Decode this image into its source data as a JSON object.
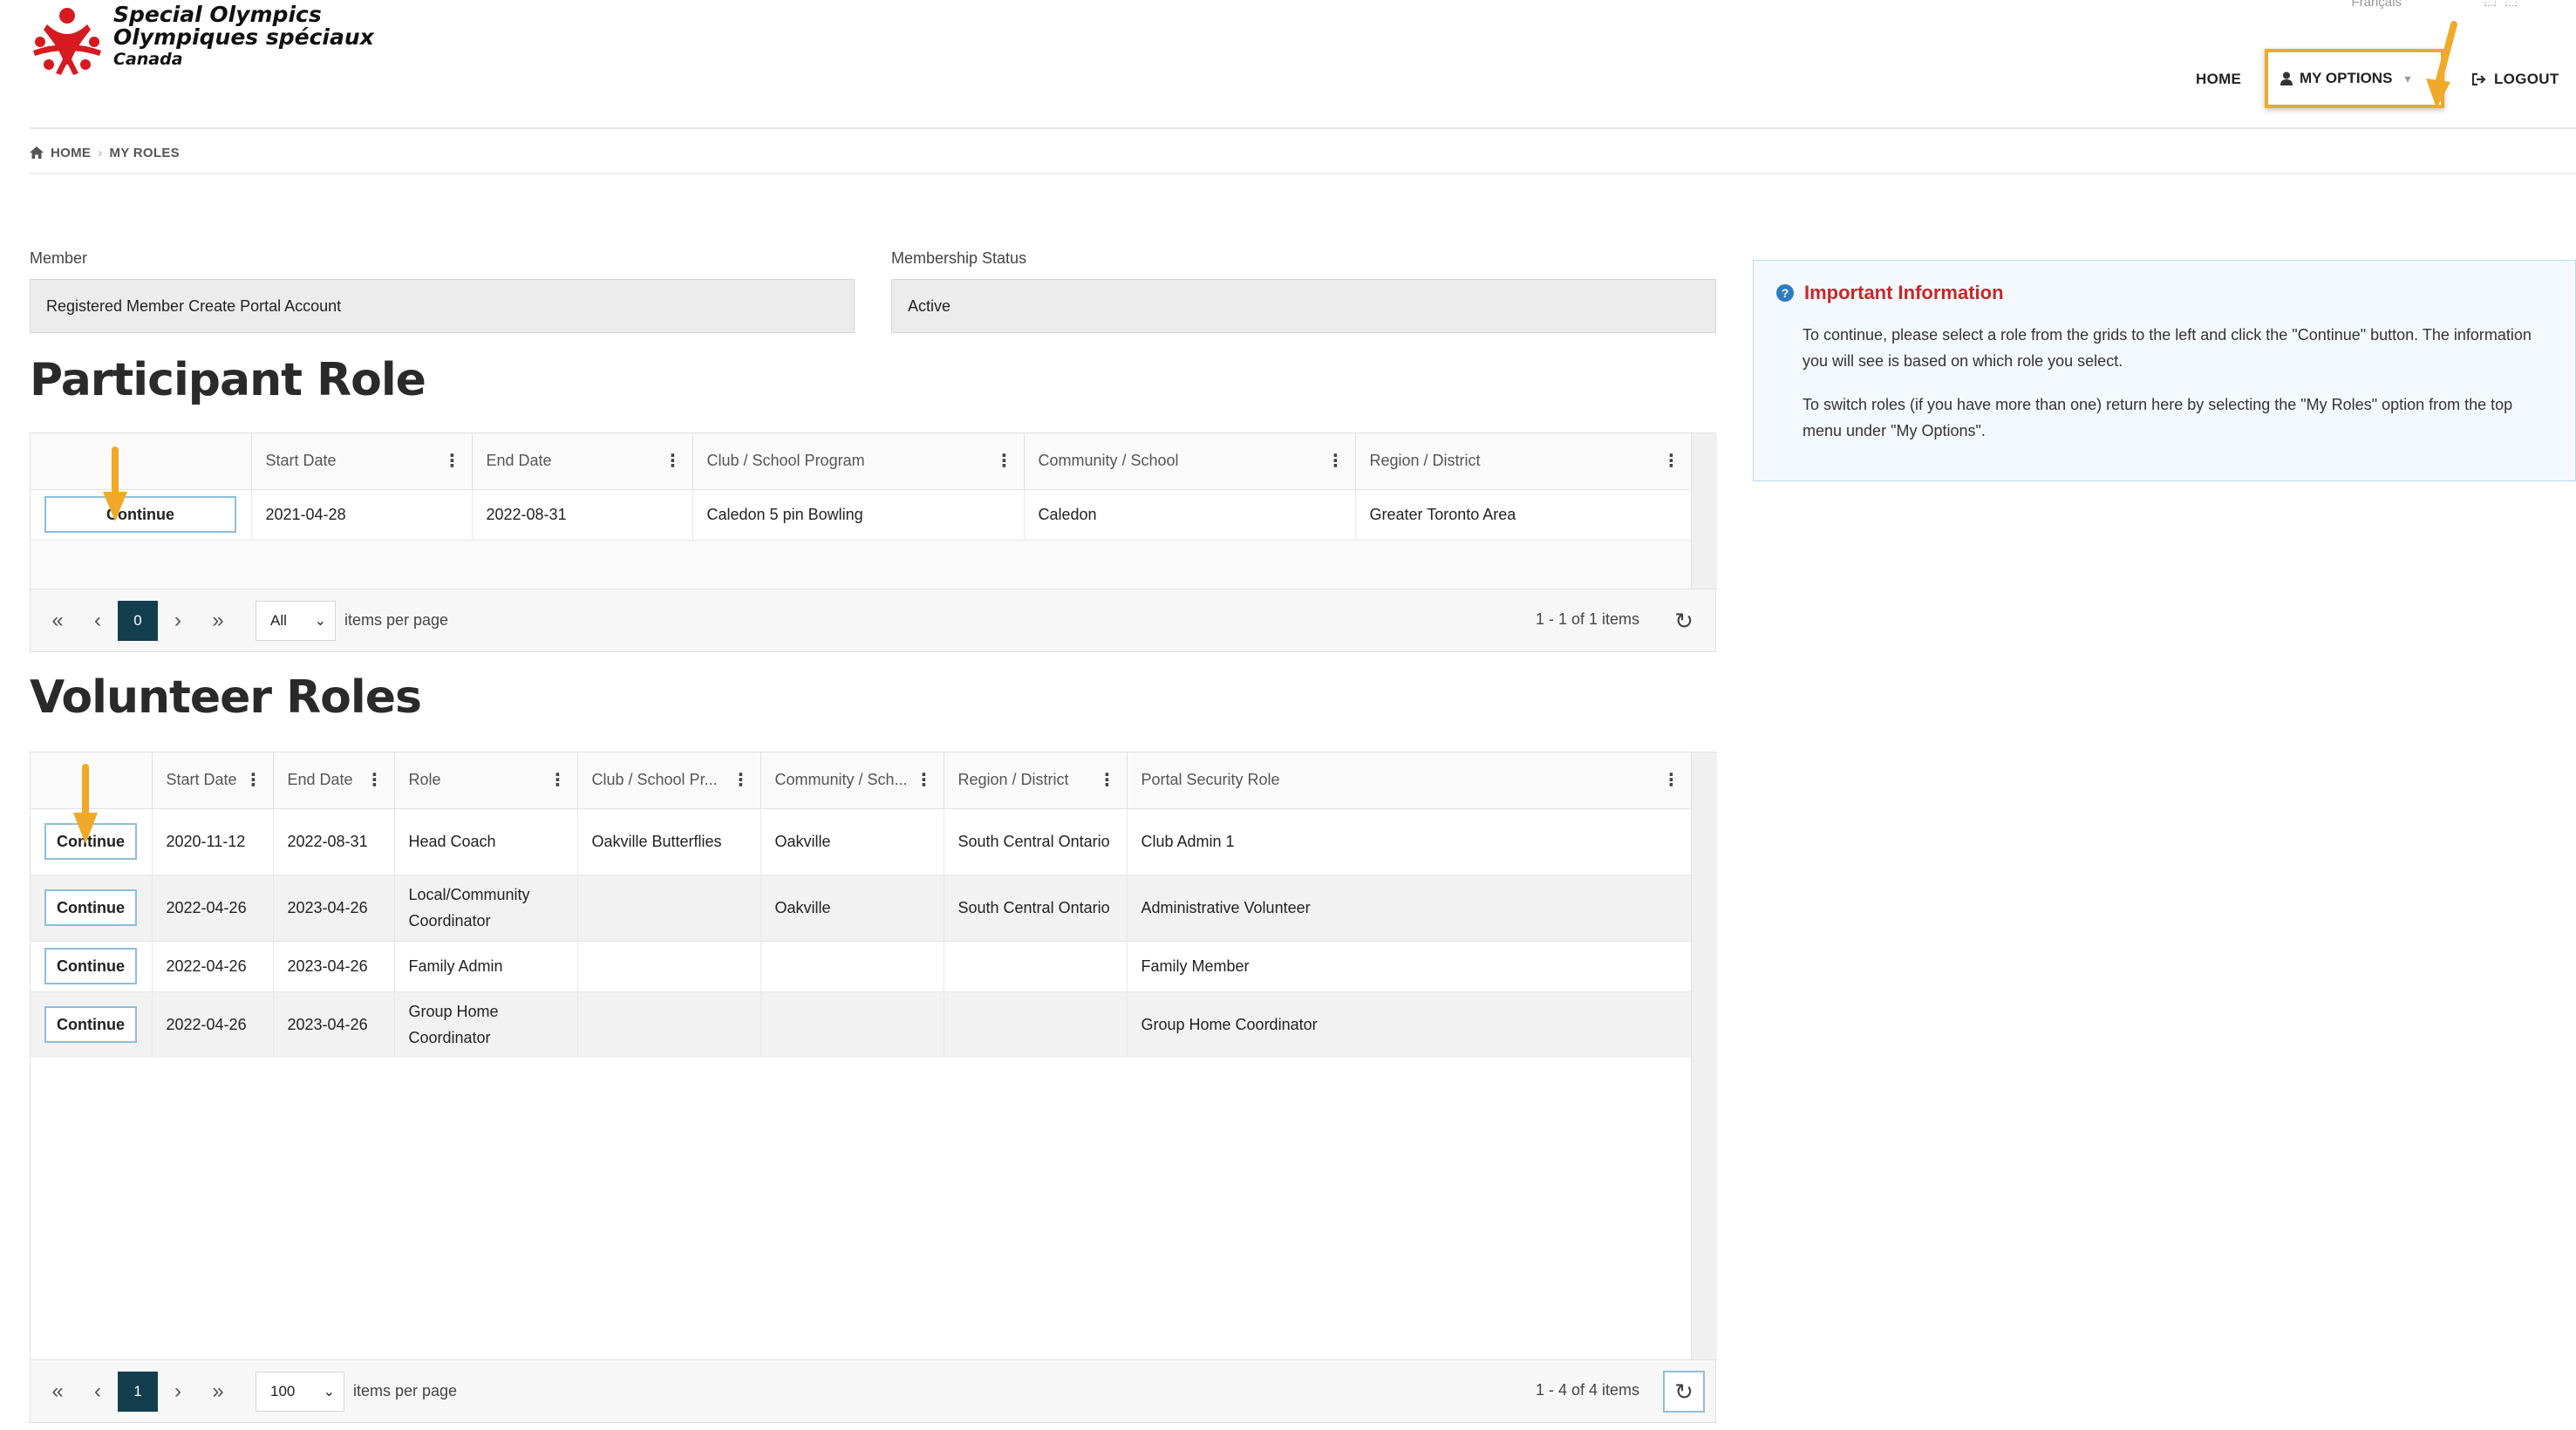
{
  "header": {
    "logo_lines": [
      "Special Olympics",
      "Olympiques spéciaux",
      "Canada"
    ],
    "lang_link": "Français",
    "nav": {
      "home": "HOME",
      "my_options": "MY OPTIONS",
      "logout": "LOGOUT"
    }
  },
  "breadcrumb": {
    "home": "HOME",
    "current": "MY ROLES"
  },
  "member": {
    "member_label": "Member",
    "member_value": "Registered Member Create Portal Account",
    "status_label": "Membership Status",
    "status_value": "Active"
  },
  "participant": {
    "title": "Participant Role",
    "columns": [
      "",
      "Start Date",
      "End Date",
      "Club / School Program",
      "Community / School",
      "Region / District"
    ],
    "rows": [
      {
        "action": "Continue",
        "start": "2021-04-28",
        "end": "2022-08-31",
        "club": "Caledon 5 pin Bowling",
        "community": "Caledon",
        "region": "Greater Toronto Area"
      }
    ],
    "pager": {
      "current_page": "0",
      "page_size": "All",
      "items_per_page": "items per page",
      "info": "1 - 1 of 1 items"
    }
  },
  "volunteer": {
    "title": "Volunteer Roles",
    "columns": [
      "",
      "Start Date",
      "End Date",
      "Role",
      "Club / School Pr...",
      "Community / Sch...",
      "Region / District",
      "Portal Security Role"
    ],
    "rows": [
      {
        "action": "Continue",
        "start": "2020-11-12",
        "end": "2022-08-31",
        "role": "Head Coach",
        "club": "Oakville Butterflies",
        "community": "Oakville",
        "region": "South Central Ontario",
        "security": "Club Admin 1"
      },
      {
        "action": "Continue",
        "start": "2022-04-26",
        "end": "2023-04-26",
        "role": "Local/Community Coordinator",
        "club": "",
        "community": "Oakville",
        "region": "South Central Ontario",
        "security": "Administrative Volunteer"
      },
      {
        "action": "Continue",
        "start": "2022-04-26",
        "end": "2023-04-26",
        "role": "Family Admin",
        "club": "",
        "community": "",
        "region": "",
        "security": "Family Member"
      },
      {
        "action": "Continue",
        "start": "2022-04-26",
        "end": "2023-04-26",
        "role": "Group Home Coordinator",
        "club": "",
        "community": "",
        "region": "",
        "security": "Group Home Coordinator"
      }
    ],
    "pager": {
      "current_page": "1",
      "page_size": "100",
      "items_per_page": "items per page",
      "info": "1 - 4 of 4 items"
    }
  },
  "info_box": {
    "title": "Important Information",
    "p1": "To continue, please select a role from the grids to the left and click the \"Continue\" button. The information you will see is based on which role you select.",
    "p2": "To switch roles (if you have more than one) return here by selecting the \"My Roles\" option from the top menu under \"My Options\"."
  },
  "icons": {
    "home": "home-icon",
    "user": "user-icon",
    "logout": "logout-icon",
    "info": "question-circle-icon",
    "first": "first-page-icon",
    "prev": "prev-page-icon",
    "next": "next-page-icon",
    "last": "last-page-icon",
    "refresh": "refresh-icon",
    "column_menu": "column-menu-icon",
    "dropdown": "chevron-down-icon",
    "arrow": "annotation-arrow-icon"
  },
  "colors": {
    "brand_red": "#d71920",
    "pager_active": "#123e4e",
    "accent_orange": "#f0a928",
    "info_title": "#c62828"
  }
}
